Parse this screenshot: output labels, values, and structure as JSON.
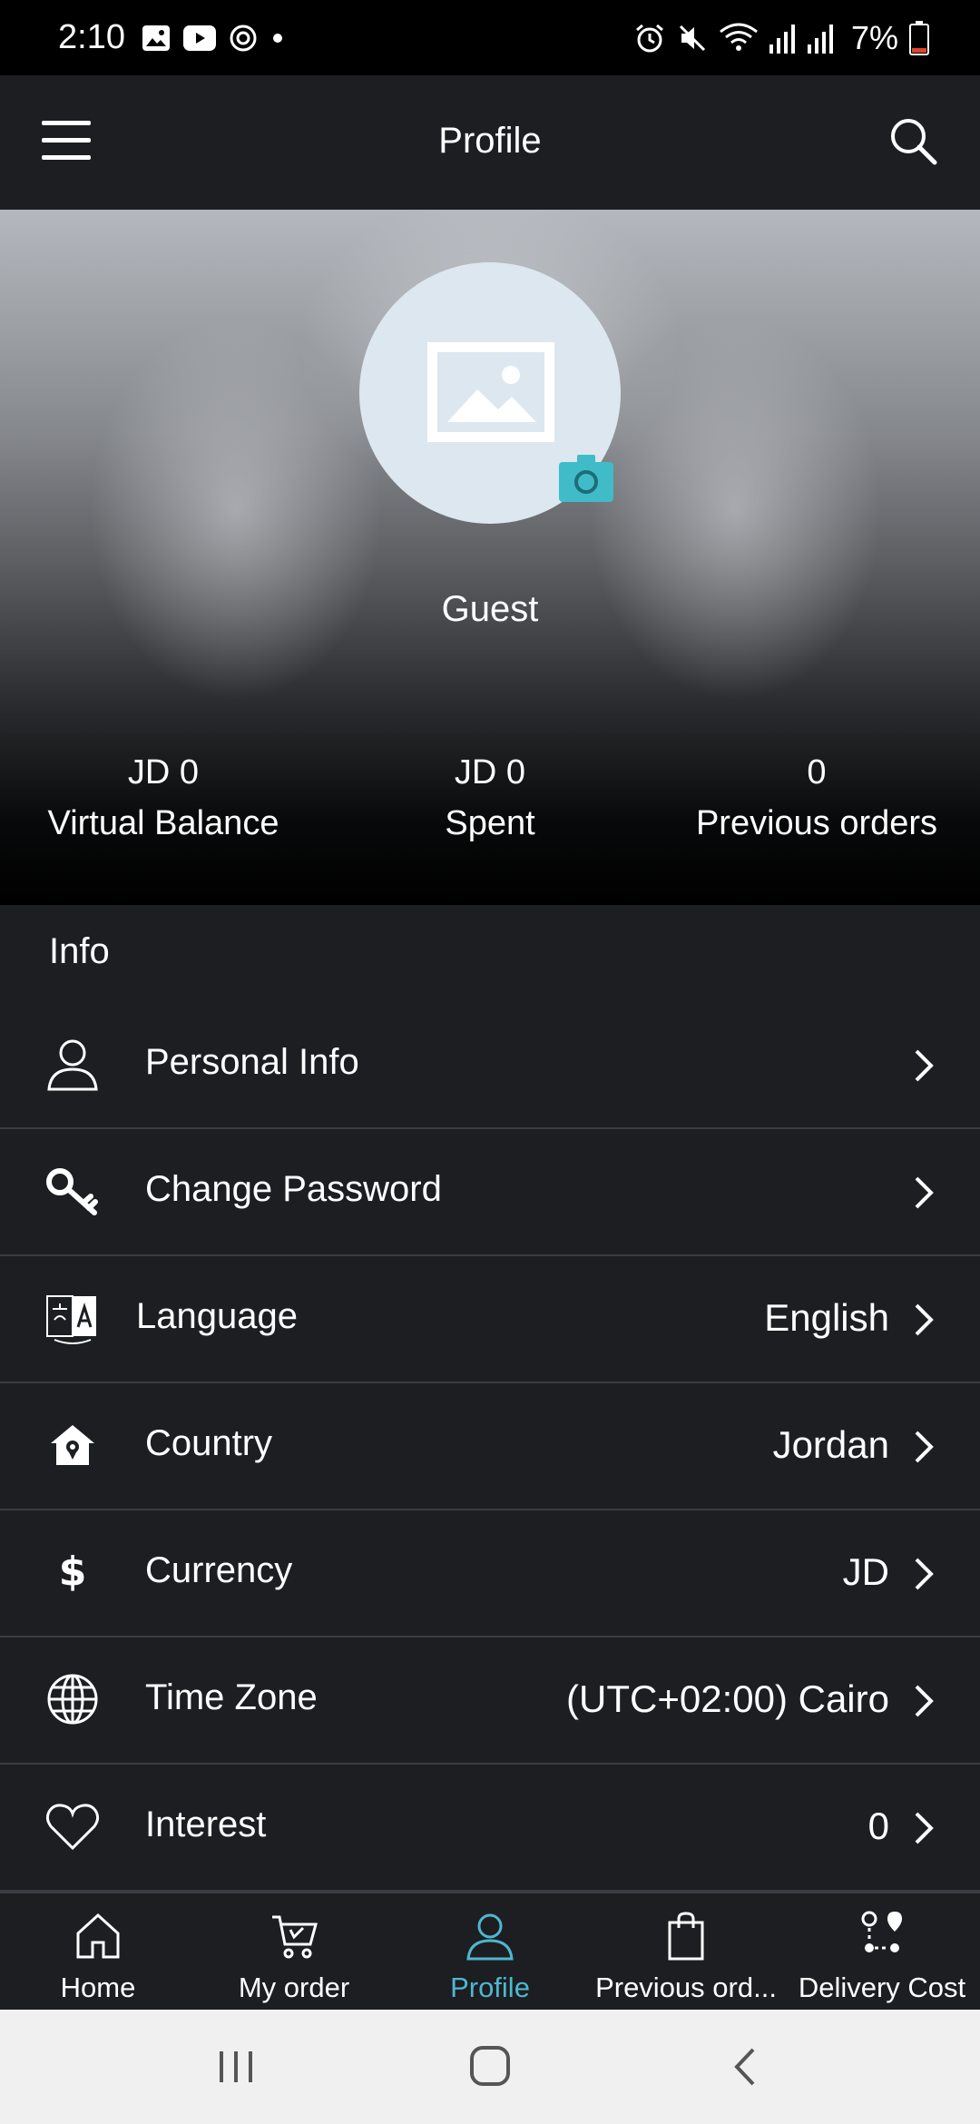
{
  "status_bar": {
    "time": "2:10",
    "battery_percent": "7%",
    "left_icons": [
      "image-icon",
      "youtube-icon",
      "sync-icon",
      "dot-icon"
    ],
    "right_icons": [
      "alarm-icon",
      "mute-icon",
      "wifi-icon",
      "signal-icon",
      "signal-icon",
      "battery-icon"
    ]
  },
  "app_bar": {
    "title": "Profile",
    "menu_icon": "hamburger-menu-icon",
    "search_icon": "search-icon"
  },
  "profile": {
    "name": "Guest",
    "stats": [
      {
        "value": "JD 0",
        "label": "Virtual Balance"
      },
      {
        "value": "JD 0",
        "label": "Spent"
      },
      {
        "value": "0",
        "label": "Previous orders"
      }
    ]
  },
  "info": {
    "title": "Info",
    "rows": [
      {
        "label": "Personal Info",
        "value": "",
        "icon": "person-icon"
      },
      {
        "label": "Change Password",
        "value": "",
        "icon": "key-icon"
      },
      {
        "label": "Language",
        "value": "English",
        "icon": "translate-icon"
      },
      {
        "label": "Country",
        "value": "Jordan",
        "icon": "home-location-icon"
      },
      {
        "label": "Currency",
        "value": "JD",
        "icon": "dollar-icon"
      },
      {
        "label": "Time Zone",
        "value": "(UTC+02:00) Cairo",
        "icon": "globe-icon"
      },
      {
        "label": "Interest",
        "value": "0",
        "icon": "heart-icon"
      }
    ]
  },
  "bottom_nav": {
    "active": "Profile",
    "accent": "#4fb6cf",
    "items": [
      {
        "label": "Home",
        "icon": "home-icon"
      },
      {
        "label": "My order",
        "icon": "cart-icon"
      },
      {
        "label": "Profile",
        "icon": "profile-icon"
      },
      {
        "label": "Previous ord...",
        "icon": "bag-icon"
      },
      {
        "label": "Delivery Cost",
        "icon": "route-icon"
      }
    ]
  },
  "system_nav": [
    "recents-icon",
    "home-square-icon",
    "back-icon"
  ],
  "colors": {
    "background": "#1c1e22",
    "divider": "#393c42",
    "avatar_bg": "#dde7ef",
    "camera_badge": "#3fbcc8"
  }
}
